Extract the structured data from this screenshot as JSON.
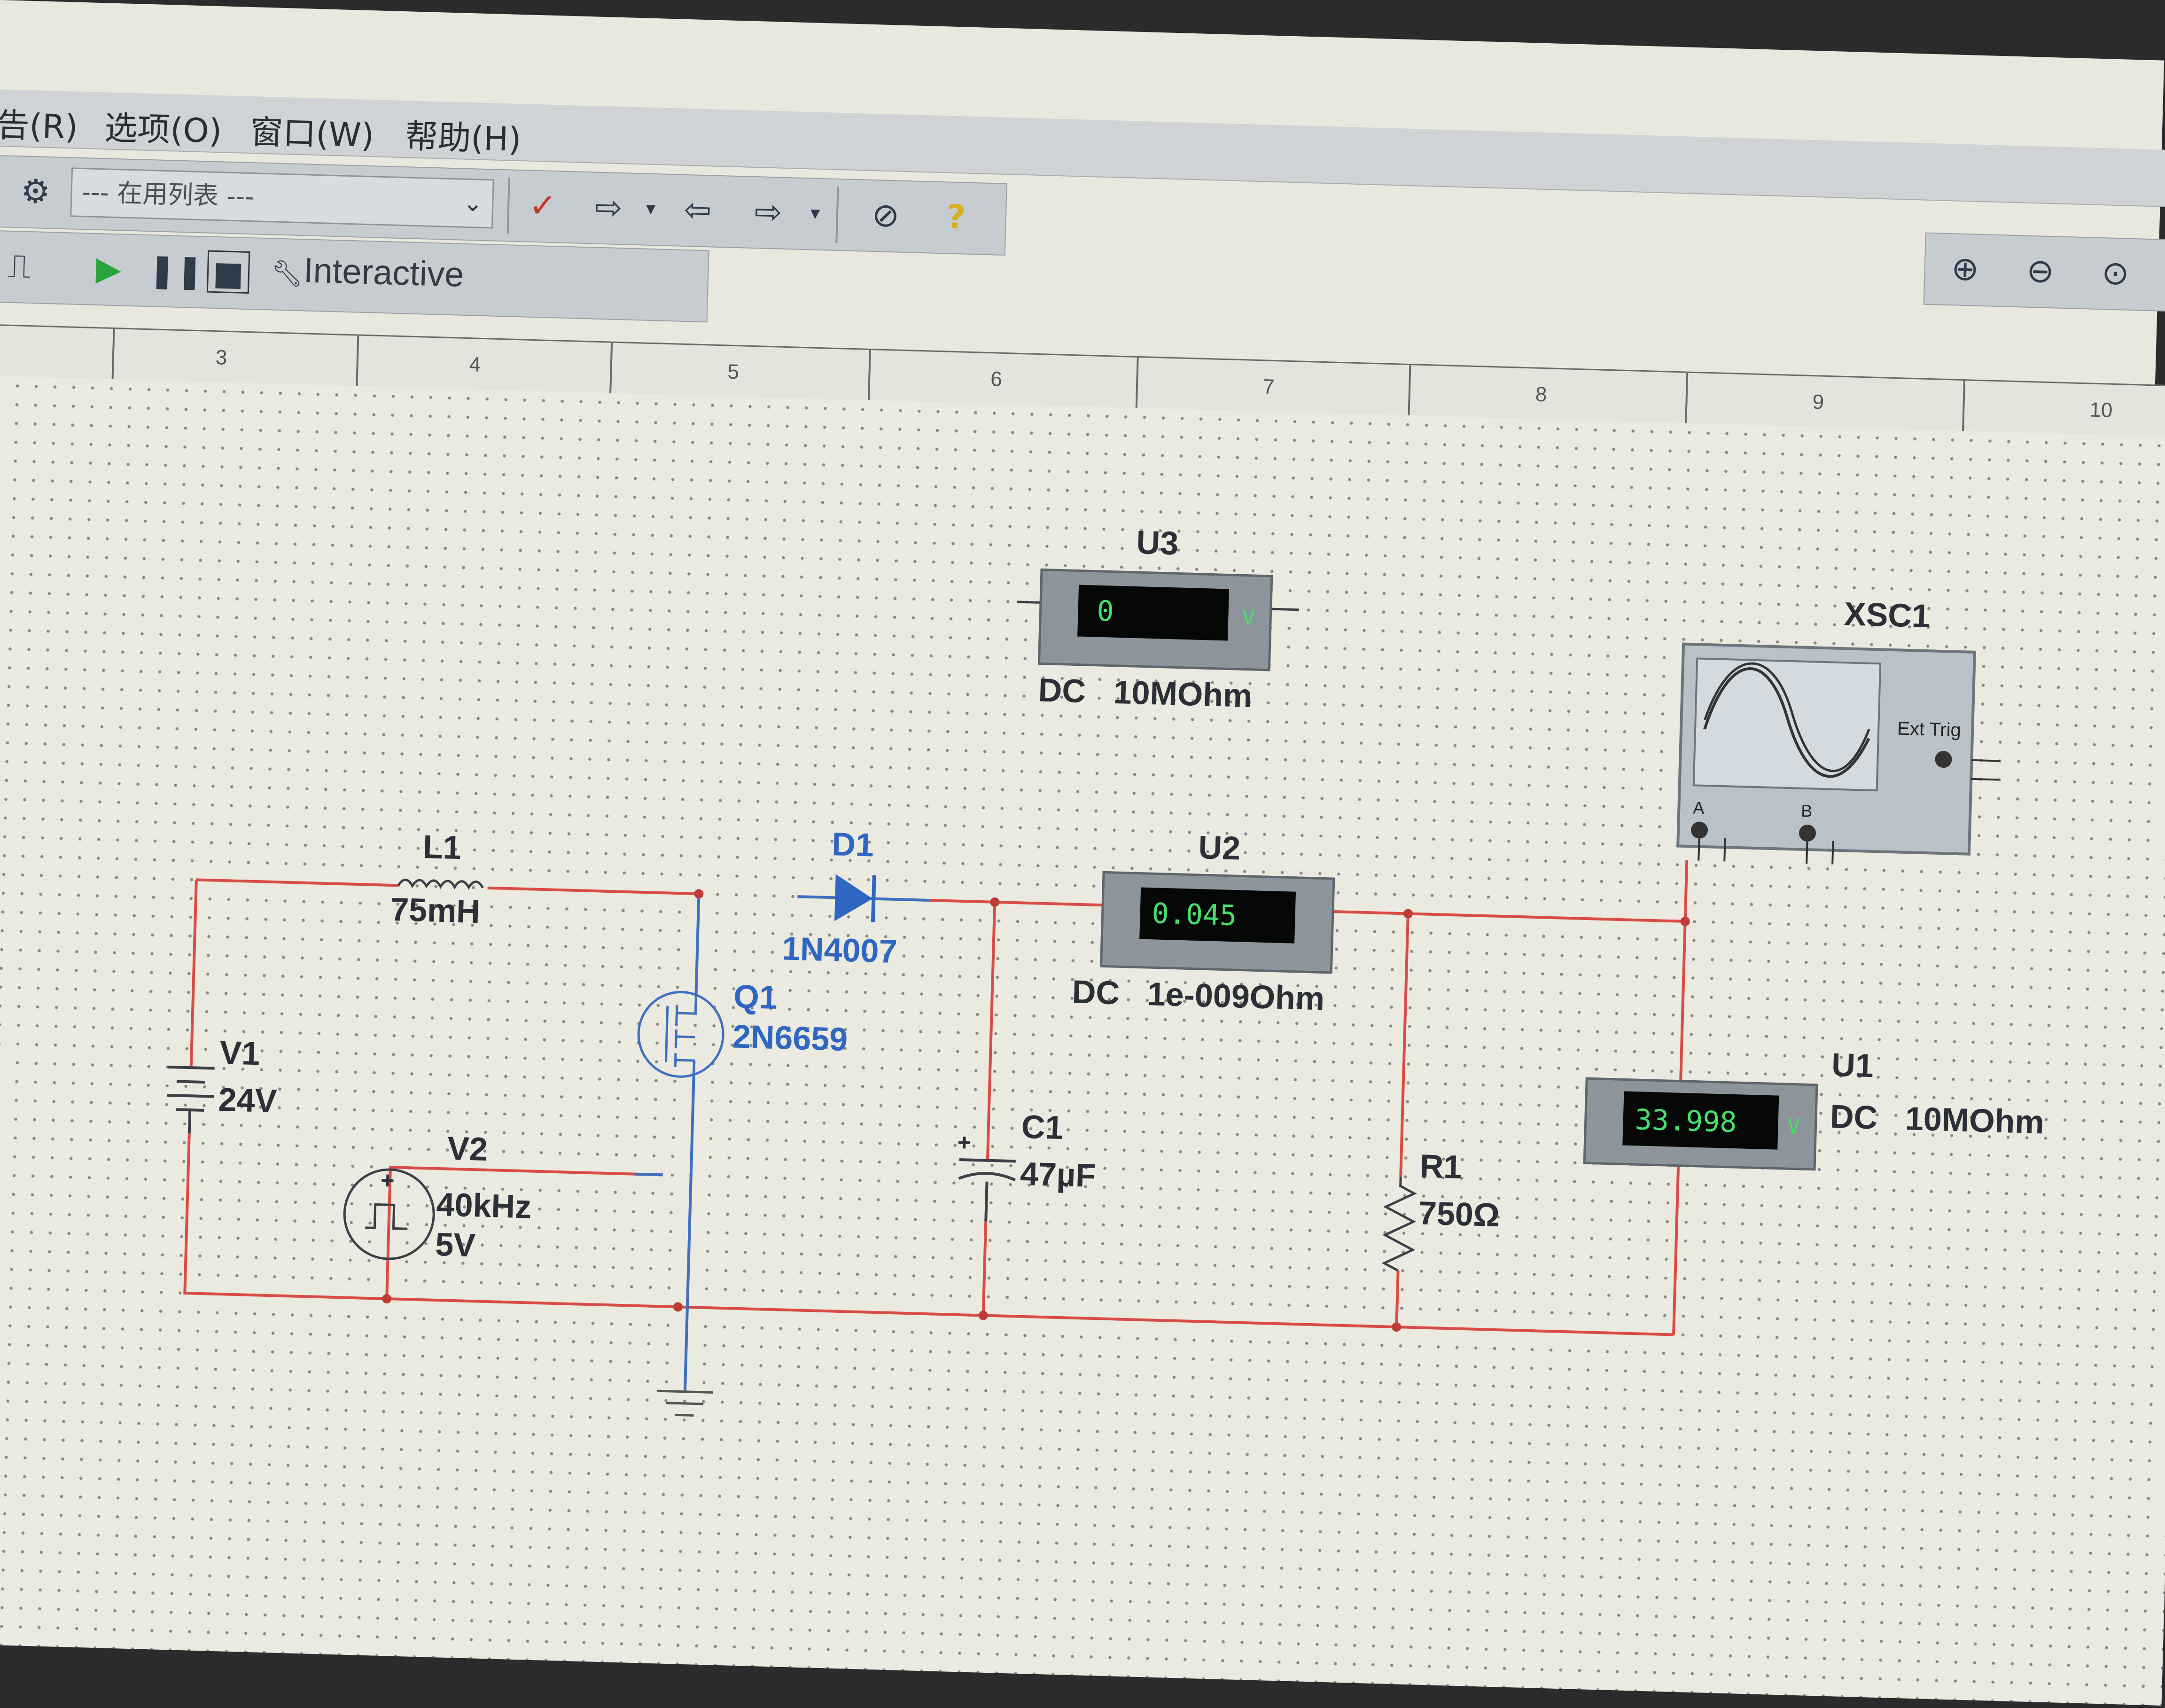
{
  "menu": {
    "items": [
      "告(R)",
      "选项(O)",
      "窗口(W)",
      "帮助(H)"
    ]
  },
  "toolbar": {
    "inuse_list": "--- 在用列表 ---",
    "interactive": "Interactive"
  },
  "ruler": {
    "numbers": [
      "3",
      "4",
      "5",
      "6",
      "7",
      "8",
      "9",
      "10"
    ]
  },
  "schematic": {
    "L1": {
      "name": "L1",
      "value": "75mH"
    },
    "D1": {
      "name": "D1",
      "value": "1N4007"
    },
    "V1": {
      "name": "V1",
      "value": "24V"
    },
    "V2": {
      "name": "V2",
      "freq": "40kHz",
      "amp": "5V"
    },
    "Q1": {
      "name": "Q1",
      "value": "2N6659"
    },
    "C1": {
      "name": "C1",
      "value": "47µF"
    },
    "R1": {
      "name": "R1",
      "value": "750Ω"
    },
    "U3": {
      "name": "U3",
      "reading": "0",
      "unit": "V",
      "mode": "DC",
      "resistance": "10MOhm"
    },
    "U2": {
      "name": "U2",
      "reading": "0.045",
      "mode": "DC",
      "resistance": "1e-009Ohm"
    },
    "U1": {
      "name": "U1",
      "reading": "33.998",
      "unit": "V",
      "mode": "DC",
      "resistance": "10MOhm"
    },
    "XSC1": {
      "name": "XSC1",
      "ext_trig": "Ext Trig",
      "channel_a": "A",
      "channel_b": "B"
    }
  },
  "colors": {
    "wire": "#d94c45",
    "wire_blue": "#3f6fbf",
    "meter_digits": "#46e06a"
  }
}
